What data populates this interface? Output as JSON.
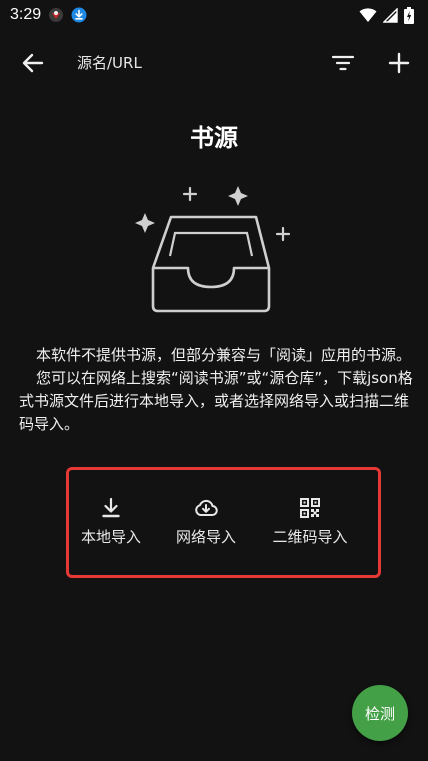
{
  "status_bar": {
    "time": "3:29",
    "icons": [
      "notification-app-icon",
      "download-icon",
      "wifi-icon",
      "signal-icon",
      "battery-icon"
    ]
  },
  "toolbar": {
    "title": "源名/URL",
    "icons": [
      "back-arrow-icon",
      "filter-icon",
      "add-icon"
    ]
  },
  "empty_state": {
    "title": "书源",
    "illustration": "empty-inbox-icon",
    "paragraph1": "本软件不提供书源，但部分兼容与「阅读」应用的书源。",
    "paragraph2": "您可以在网络上搜索“阅读书源”或“源仓库”，下载json格式书源文件后进行本地导入，或者选择网络导入或扫描二维码导入。"
  },
  "import_options": {
    "local": {
      "label": "本地导入",
      "icon": "download-icon"
    },
    "network": {
      "label": "网络导入",
      "icon": "cloud-download-icon"
    },
    "qr": {
      "label": "二维码导入",
      "icon": "qr-code-icon"
    }
  },
  "fab": {
    "label": "检测"
  },
  "colors": {
    "background": "#121212",
    "highlight_border": "#e53935",
    "fab": "#43a047"
  }
}
